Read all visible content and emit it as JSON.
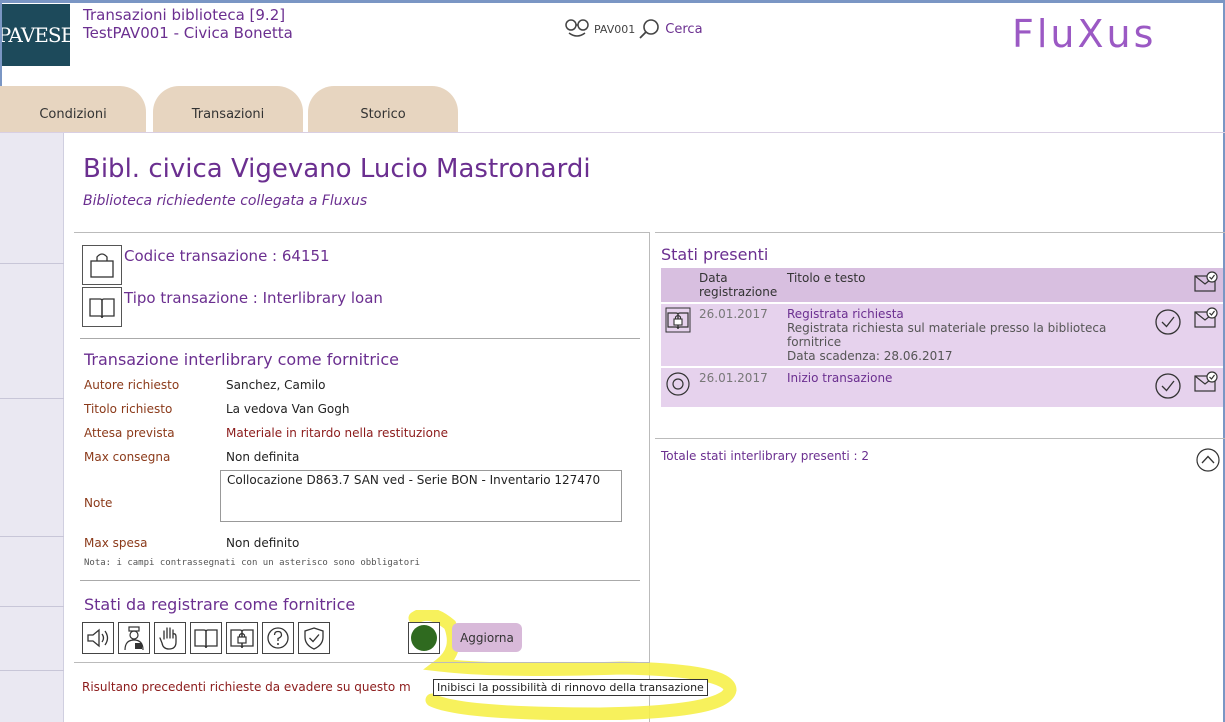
{
  "header": {
    "logo_text": "PAVESE",
    "app_title": "Transazioni biblioteca [9.2]",
    "app_subtitle": "TestPAV001 - Civica Bonetta",
    "user_code": "PAV001",
    "search_label": "Cerca",
    "brand": "FluXus"
  },
  "tabs": [
    {
      "label": "Condizioni"
    },
    {
      "label": "Transazioni"
    },
    {
      "label": "Storico"
    }
  ],
  "library": {
    "title": "Bibl. civica Vigevano Lucio Mastronardi",
    "subtitle": "Biblioteca richiedente collegata a Fluxus"
  },
  "transaction": {
    "code_label": "Codice transazione : 64151",
    "type_label": "Tipo transazione : Interlibrary loan"
  },
  "details": {
    "section_title": "Transazione interlibrary come fornitrice",
    "fields": [
      {
        "label": "Autore richiesto",
        "value": "Sanchez, Camilo"
      },
      {
        "label": "Titolo richiesto",
        "value": "La vedova Van Gogh"
      },
      {
        "label": "Attesa prevista",
        "value": "Materiale in ritardo nella restituzione"
      },
      {
        "label": "Max consegna",
        "value": "Non definita"
      },
      {
        "label": "Note",
        "value": "Collocazione D863.7 SAN ved - Serie BON - Inventario 127470"
      },
      {
        "label": "Max spesa",
        "value": "Non definito"
      }
    ],
    "footnote": "Nota: i campi contrassegnati con un asterisco sono obbligatori"
  },
  "states_to_register": {
    "title": "Stati da registrare come fornitrice",
    "buttons": [
      "speaker-icon",
      "courier-icon",
      "hand-stop-icon",
      "book-open-icon",
      "book-lock-icon",
      "question-icon",
      "shield-check-icon",
      "green-dot-icon"
    ],
    "update_label": "Aggiorna"
  },
  "warning_message": "Risultano precedenti richieste da evadere su questo m",
  "tooltip": "Inibisci la possibilità di rinnovo della transazione",
  "present_states": {
    "title": "Stati presenti",
    "headers": {
      "date": "Data registrazione",
      "title": "Titolo e testo"
    },
    "rows": [
      {
        "icon": "book-lock-icon",
        "date": "26.01.2017",
        "title": "Registrata richiesta",
        "text": "Registrata richiesta sul materiale presso la biblioteca fornitrice",
        "extra": "Data scadenza: 28.06.2017"
      },
      {
        "icon": "target-icon",
        "date": "26.01.2017",
        "title": "Inizio transazione",
        "text": "",
        "extra": ""
      }
    ],
    "total_label": "Totale stati interlibrary presenti : 2"
  },
  "colors": {
    "accent": "#6b2f90",
    "tab_bg": "#e7d5c0",
    "table_header": "#d8bfe0",
    "table_row": "#e6d2ed",
    "highlight": "#f6f04a",
    "status_dot": "#2f6a1f"
  }
}
